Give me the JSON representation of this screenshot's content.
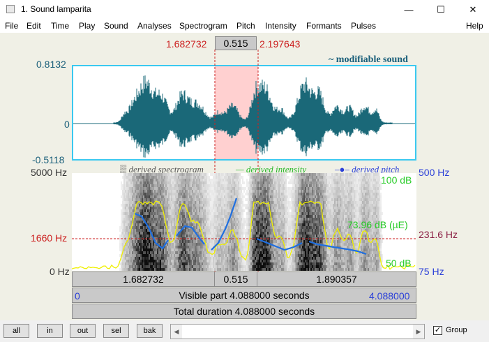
{
  "window": {
    "title": "1. Sound lamparita",
    "minimize": "—",
    "maximize": "☐",
    "close": "✕"
  },
  "menu": [
    "File",
    "Edit",
    "Time",
    "Play",
    "Sound",
    "Analyses",
    "Spectrogram",
    "Pitch",
    "Intensity",
    "Formants",
    "Pulses",
    "Help"
  ],
  "selection": {
    "start": "1.682732",
    "duration": "0.515",
    "end": "2.197643"
  },
  "waveform": {
    "label": "~ modifiable sound",
    "y_max": "0.8132",
    "y_zero": "0",
    "y_min": "-0.5118"
  },
  "legend": {
    "spectrogram": "derived spectrogram",
    "intensity": "derived intensity",
    "pitch": "derived pitch"
  },
  "spectrogram_axis": {
    "top_hz": "5000 Hz",
    "cursor_hz": "1660 Hz",
    "bottom_hz": "0 Hz",
    "pitch_top": "500 Hz",
    "pitch_cursor": "231.6 Hz",
    "pitch_bottom": "75 Hz",
    "int_top": "100 dB",
    "int_cursor": "73.96 dB (µE)",
    "int_bottom": "50 dB"
  },
  "time_bar": {
    "left": "1.682732",
    "mid": "0.515",
    "right": "1.890357"
  },
  "visible_bar": {
    "start": "0",
    "text": "Visible part 4.088000 seconds",
    "end": "4.088000"
  },
  "total_bar": {
    "text": "Total duration 4.088000 seconds"
  },
  "buttons": [
    "all",
    "in",
    "out",
    "sel",
    "bak"
  ],
  "group": {
    "label": "Group",
    "checked": "✓"
  },
  "colors": {
    "selection": "#ffd0d0",
    "wave": "#1a6878",
    "pitch": "#1f6fe0",
    "intensity": "#f0f000",
    "accent_frame": "#3ac9f0"
  }
}
